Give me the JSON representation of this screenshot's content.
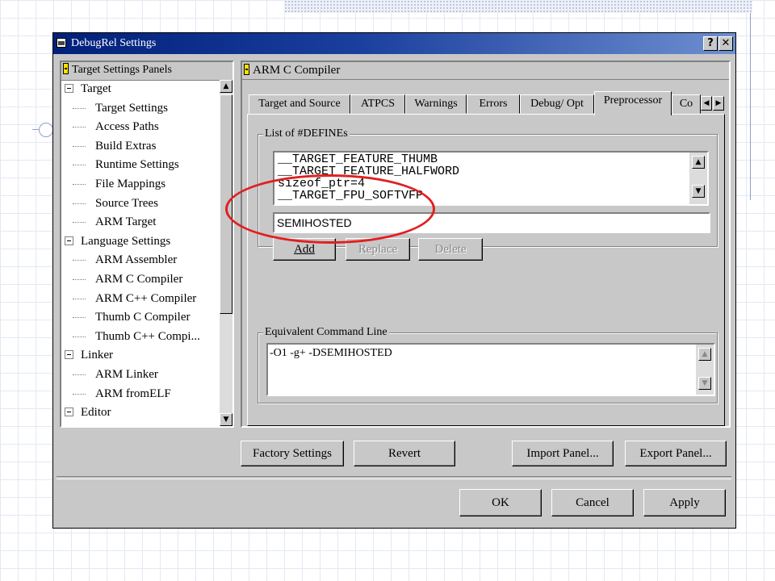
{
  "window": {
    "title": "DebugRel Settings",
    "help_label": "?",
    "close_label": "✕"
  },
  "tree": {
    "header": "Target Settings Panels",
    "items": [
      {
        "label": "Target",
        "level": 0
      },
      {
        "label": "Target Settings",
        "level": 1
      },
      {
        "label": "Access Paths",
        "level": 1
      },
      {
        "label": "Build Extras",
        "level": 1
      },
      {
        "label": "Runtime Settings",
        "level": 1
      },
      {
        "label": "File Mappings",
        "level": 1
      },
      {
        "label": "Source Trees",
        "level": 1
      },
      {
        "label": "ARM Target",
        "level": 1
      },
      {
        "label": "Language Settings",
        "level": 0
      },
      {
        "label": "ARM Assembler",
        "level": 1
      },
      {
        "label": "ARM C Compiler",
        "level": 1
      },
      {
        "label": "ARM C++ Compiler",
        "level": 1
      },
      {
        "label": "Thumb C Compiler",
        "level": 1
      },
      {
        "label": "Thumb C++ Compi...",
        "level": 1
      },
      {
        "label": "Linker",
        "level": 0
      },
      {
        "label": "ARM Linker",
        "level": 1
      },
      {
        "label": "ARM fromELF",
        "level": 1
      },
      {
        "label": "Editor",
        "level": 0
      }
    ]
  },
  "panel": {
    "title": "ARM C Compiler",
    "tabs": [
      "Target and Source",
      "ATPCS",
      "Warnings",
      "Errors",
      "Debug/ Opt",
      "Preprocessor",
      "Co"
    ],
    "active_tab": "Preprocessor",
    "defines": {
      "legend": "List of #DEFINEs",
      "items": [
        "__TARGET_FEATURE_THUMB",
        "__TARGET_FEATURE_HALFWORD",
        "sizeof_ptr=4",
        "__TARGET_FPU_SOFTVFP"
      ],
      "input_value": "SEMIHOSTED",
      "add_label": "Add",
      "replace_label": "Replace",
      "delete_label": "Delete"
    },
    "command_line": {
      "legend": "Equivalent Command Line",
      "value": "-O1 -g+ -DSEMIHOSTED"
    }
  },
  "footer": {
    "factory_label": "Factory Settings",
    "revert_label": "Revert",
    "import_label": "Import Panel...",
    "export_label": "Export Panel...",
    "ok_label": "OK",
    "cancel_label": "Cancel",
    "apply_label": "Apply"
  },
  "colors": {
    "highlight": "#e02020",
    "titlebar": "#00207a"
  }
}
